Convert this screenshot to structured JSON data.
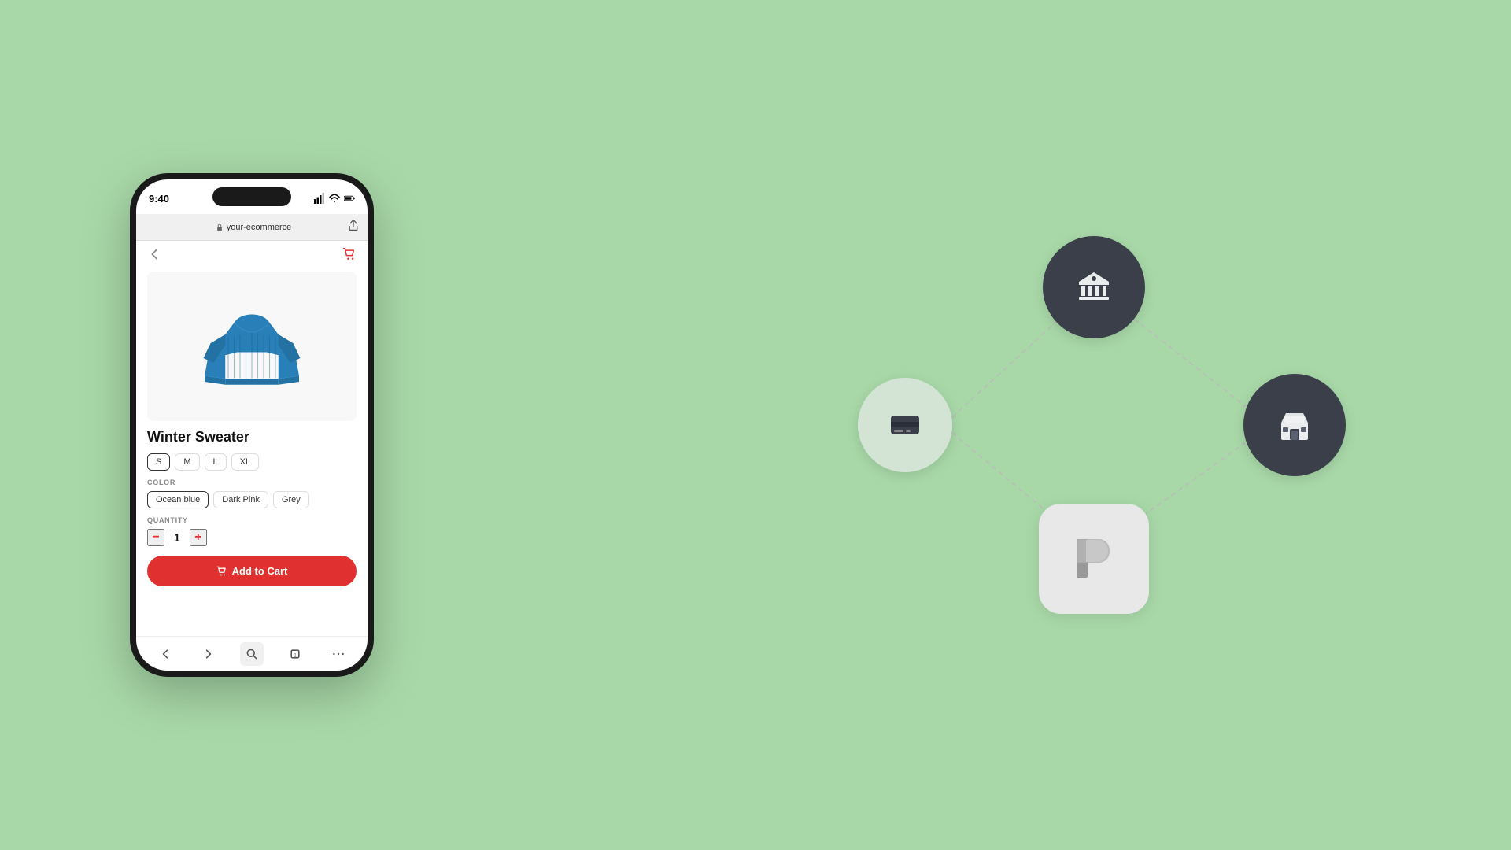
{
  "page": {
    "background_color": "#a8d8a8"
  },
  "phone": {
    "status": {
      "time": "9:40",
      "signal_bars": "signal",
      "wifi": "wifi",
      "battery": "battery"
    },
    "browser": {
      "url": "your-ecommerce",
      "lock_icon": "lock"
    },
    "nav": {
      "back_icon": "chevron-left",
      "cart_icon": "cart"
    },
    "product": {
      "name": "Winter Sweater",
      "image_alt": "Blue knit sweater",
      "sizes": [
        "S",
        "M",
        "L",
        "XL"
      ],
      "active_size": "S",
      "color_label": "COLOR",
      "colors": [
        "Ocean blue",
        "Dark Pink",
        "Grey"
      ],
      "active_color": "Ocean blue",
      "quantity_label": "QUANTITY",
      "quantity": "1",
      "add_to_cart_label": "Add to Cart",
      "cart_icon": "shopping-cart"
    },
    "bottom_nav": {
      "items": [
        "back",
        "forward",
        "search",
        "tab",
        "more"
      ]
    }
  },
  "diagram": {
    "nodes": [
      {
        "id": "bank",
        "icon": "bank",
        "type": "dark",
        "label": "Bank"
      },
      {
        "id": "card",
        "icon": "credit-card",
        "type": "light",
        "label": "Card"
      },
      {
        "id": "store",
        "icon": "store",
        "type": "dark",
        "label": "Store"
      },
      {
        "id": "logo",
        "icon": "F",
        "type": "logo",
        "label": "Logo"
      }
    ]
  }
}
